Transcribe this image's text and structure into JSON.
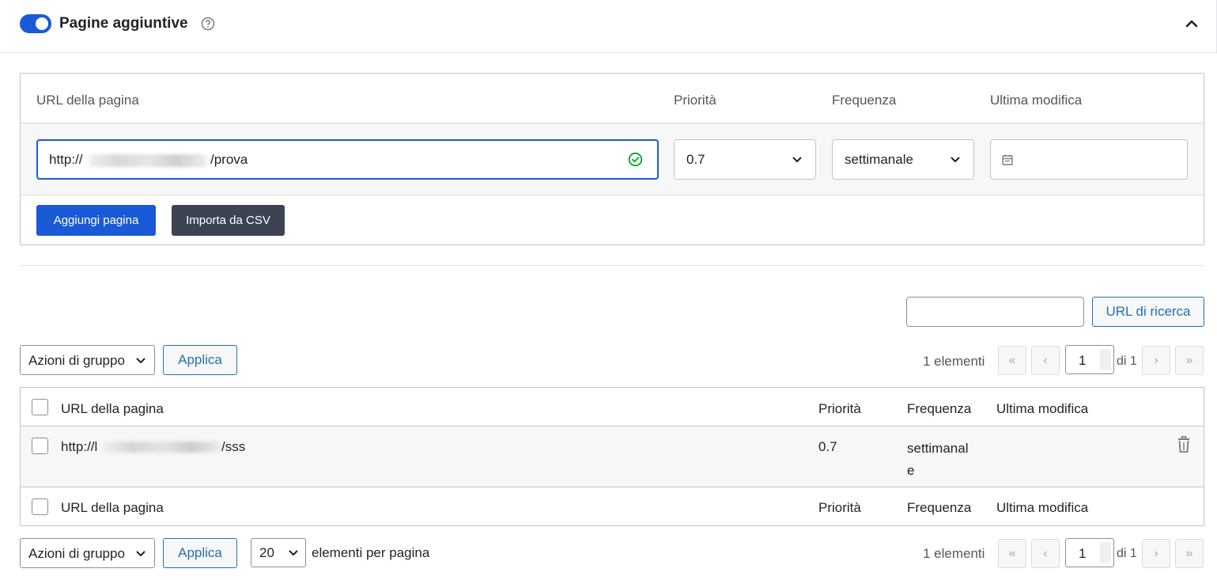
{
  "header": {
    "title": "Pagine aggiuntive",
    "toggle_on": true
  },
  "add_form": {
    "columns": [
      "URL della pagina",
      "Priorità",
      "Frequenza",
      "Ultima modifica"
    ],
    "url_prefix": "http://",
    "url_suffix": "/prova",
    "priority": "0.7",
    "frequency": "settimanale",
    "last_modified": "",
    "add_button": "Aggiungi pagina",
    "import_button": "Importa da CSV"
  },
  "search": {
    "value": "",
    "button": "URL di ricerca"
  },
  "bulk": {
    "select_label": "Azioni di gruppo",
    "apply_label": "Applica"
  },
  "pagination": {
    "count": "1 elementi",
    "first": "«",
    "prev": "‹",
    "next": "›",
    "last": "»",
    "current": "1",
    "of": "di 1",
    "per_page": "20",
    "per_page_label": "elementi per pagina"
  },
  "table": {
    "columns": [
      "URL della pagina",
      "Priorità",
      "Frequenza",
      "Ultima modifica"
    ],
    "rows": [
      {
        "url_prefix": "http://l",
        "url_suffix": "/sss",
        "priority": "0.7",
        "frequency": "settimanale",
        "last_modified": ""
      }
    ]
  },
  "colors": {
    "accent": "#1a5ad7",
    "dark_button": "#3c4454",
    "link": "#2271b1",
    "success": "#00a32a"
  },
  "icons": [
    "toggle-switch",
    "help-icon",
    "chevron-up-icon",
    "check-circle-icon",
    "chevron-down-icon",
    "calendar-icon",
    "trash-icon"
  ]
}
